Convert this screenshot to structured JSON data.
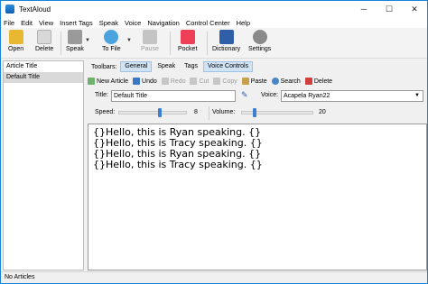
{
  "window": {
    "title": "TextAloud",
    "minimize": "─",
    "maximize": "☐",
    "close": "✕"
  },
  "menu": [
    "File",
    "Edit",
    "View",
    "Insert Tags",
    "Speak",
    "Voice",
    "Navigation",
    "Control Center",
    "Help"
  ],
  "toolbar": {
    "open": "Open",
    "delete": "Delete",
    "speak": "Speak",
    "to_file": "To File",
    "pause": "Pause",
    "pocket": "Pocket",
    "dictionary": "Dictionary",
    "settings": "Settings"
  },
  "articles": {
    "items": [
      "Article Title",
      "Default Title"
    ],
    "selected_index": 1
  },
  "tabs": {
    "label": "Toolbars:",
    "items": [
      "General",
      "Speak",
      "Tags",
      "Voice Controls"
    ],
    "active": [
      "General",
      "Voice Controls"
    ]
  },
  "actions": [
    "New Article",
    "Undo",
    "Redo",
    "Cut",
    "Copy",
    "Paste",
    "Search",
    "Delete"
  ],
  "actions_disabled": [
    "Redo",
    "Cut",
    "Copy"
  ],
  "fields": {
    "title_label": "Title:",
    "title_value": "Default Title",
    "voice_label": "Voice:",
    "voice_value": "Acapela Ryan22"
  },
  "speed": {
    "label": "Speed:",
    "value": "8"
  },
  "volume": {
    "label": "Volume:",
    "value": "20"
  },
  "editor": {
    "lines": [
      "{}Hello, this is Ryan speaking. {}",
      "{}Hello, this is Tracy speaking. {}",
      "{}Hello, this is Ryan speaking. {}",
      "{}Hello, this is Tracy speaking. {}"
    ]
  },
  "status": {
    "text": "No Articles"
  },
  "colors": {
    "accent": "#1883d7",
    "slider": "#3c7fd0",
    "tab_active": "#cfe3f5"
  }
}
